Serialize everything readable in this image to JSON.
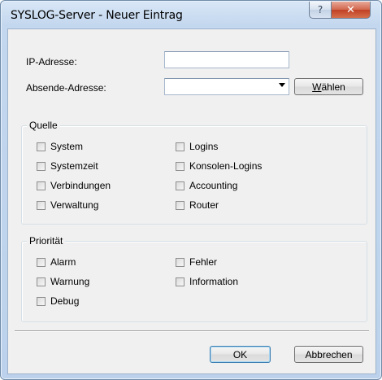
{
  "window": {
    "title": "SYSLOG-Server - Neuer Eintrag",
    "help_glyph": "?",
    "close_glyph": "✕"
  },
  "form": {
    "ip_label": "IP-Adresse:",
    "ip_value": "",
    "source_label": "Absende-Adresse:",
    "source_value": "",
    "select_button_prefix": "",
    "select_button_accel": "W",
    "select_button_rest": "ählen"
  },
  "source_group": {
    "title": "Quelle",
    "left": [
      {
        "label": "System",
        "checked": false
      },
      {
        "label": "Systemzeit",
        "checked": false
      },
      {
        "label": "Verbindungen",
        "checked": false
      },
      {
        "label": "Verwaltung",
        "checked": false
      }
    ],
    "right": [
      {
        "label": "Logins",
        "checked": false
      },
      {
        "label": "Konsolen-Logins",
        "checked": false
      },
      {
        "label": "Accounting",
        "checked": false
      },
      {
        "label": "Router",
        "checked": false
      }
    ]
  },
  "priority_group": {
    "title": "Priorität",
    "left": [
      {
        "label": "Alarm",
        "checked": false
      },
      {
        "label": "Warnung",
        "checked": false
      },
      {
        "label": "Debug",
        "checked": false
      }
    ],
    "right": [
      {
        "label": "Fehler",
        "checked": false
      },
      {
        "label": "Information",
        "checked": false
      }
    ]
  },
  "footer": {
    "ok_label": "OK",
    "cancel_label": "Abbrechen"
  },
  "colors": {
    "frame": "#c3d7ee",
    "client": "#f0f0f0",
    "close": "#c24125"
  }
}
